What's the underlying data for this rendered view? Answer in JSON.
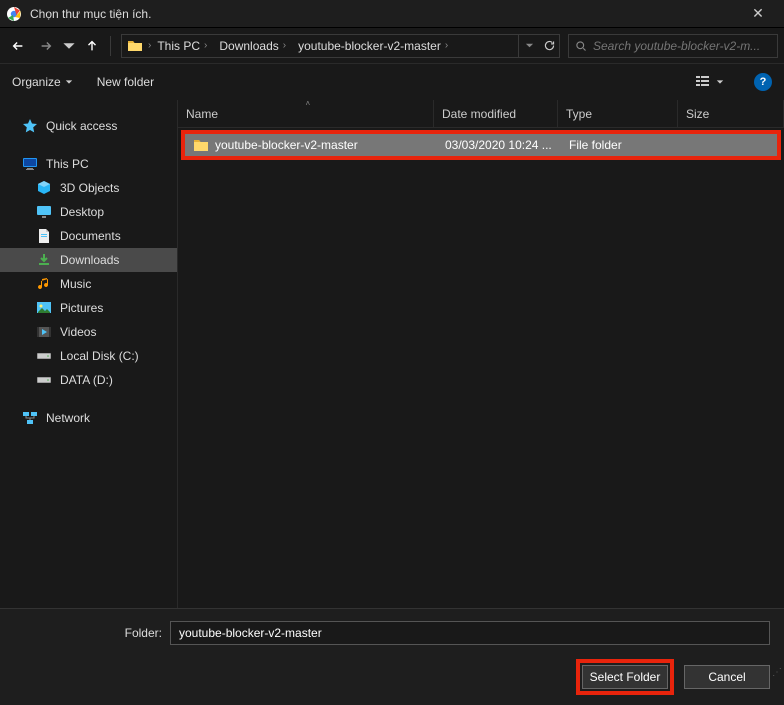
{
  "titlebar": {
    "title": "Chọn thư mục tiện ích."
  },
  "breadcrumb": {
    "items": [
      "This PC",
      "Downloads",
      "youtube-blocker-v2-master"
    ]
  },
  "search": {
    "placeholder": "Search youtube-blocker-v2-m..."
  },
  "toolbar": {
    "organize": "Organize",
    "newfolder": "New folder"
  },
  "sidebar": {
    "quick_access": "Quick access",
    "this_pc": "This PC",
    "items": [
      {
        "label": "3D Objects"
      },
      {
        "label": "Desktop"
      },
      {
        "label": "Documents"
      },
      {
        "label": "Downloads"
      },
      {
        "label": "Music"
      },
      {
        "label": "Pictures"
      },
      {
        "label": "Videos"
      },
      {
        "label": "Local Disk (C:)"
      },
      {
        "label": "DATA (D:)"
      }
    ],
    "network": "Network"
  },
  "columns": {
    "name": "Name",
    "date": "Date modified",
    "type": "Type",
    "size": "Size"
  },
  "files": [
    {
      "name": "youtube-blocker-v2-master",
      "date": "03/03/2020 10:24 ...",
      "type": "File folder"
    }
  ],
  "bottom": {
    "label": "Folder:",
    "value": "youtube-blocker-v2-master",
    "select": "Select Folder",
    "cancel": "Cancel"
  }
}
